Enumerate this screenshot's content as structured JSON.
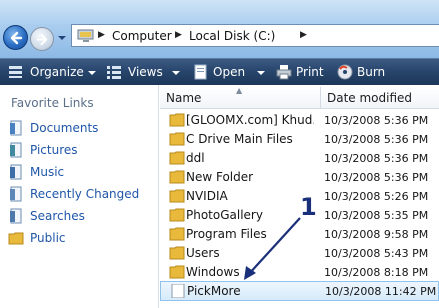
{
  "address_bar": {
    "crumbs": [
      "Computer",
      "Local Disk (C:)"
    ]
  },
  "toolbar": {
    "organize": "Organize",
    "views": "Views",
    "open": "Open",
    "print": "Print",
    "burn": "Burn"
  },
  "nav_pane": {
    "title": "Favorite Links",
    "links": [
      {
        "label": "Documents",
        "icon": "documents-icon"
      },
      {
        "label": "Pictures",
        "icon": "pictures-icon"
      },
      {
        "label": "Music",
        "icon": "music-icon"
      },
      {
        "label": "Recently Changed",
        "icon": "recently-changed-icon"
      },
      {
        "label": "Searches",
        "icon": "searches-icon"
      },
      {
        "label": "Public",
        "icon": "public-folder-icon"
      }
    ]
  },
  "file_list": {
    "columns": {
      "name": "Name",
      "date": "Date modified"
    },
    "rows": [
      {
        "name": "[GLOOMX.com] Khud...",
        "date": "10/3/2008 5:36 PM",
        "type": "folder"
      },
      {
        "name": "C Drive Main Files",
        "date": "10/3/2008 5:36 PM",
        "type": "folder"
      },
      {
        "name": "ddl",
        "date": "10/3/2008 5:36 PM",
        "type": "folder"
      },
      {
        "name": "New Folder",
        "date": "10/3/2008 5:36 PM",
        "type": "folder"
      },
      {
        "name": "NVIDIA",
        "date": "10/3/2008 5:26 PM",
        "type": "folder"
      },
      {
        "name": "PhotoGallery",
        "date": "10/3/2008 5:35 PM",
        "type": "folder"
      },
      {
        "name": "Program Files",
        "date": "10/3/2008 9:58 PM",
        "type": "folder"
      },
      {
        "name": "Users",
        "date": "10/3/2008 5:43 PM",
        "type": "folder"
      },
      {
        "name": "Windows",
        "date": "10/3/2008 8:18 PM",
        "type": "folder"
      },
      {
        "name": "PickMore",
        "date": "10/3/2008 11:42 PM",
        "type": "file"
      }
    ]
  },
  "annotation": {
    "label": "1",
    "color": "#1a2f7a"
  },
  "colors": {
    "folder": "#e8b93a",
    "link": "#1f56a8",
    "toolbar": "#27456b"
  }
}
